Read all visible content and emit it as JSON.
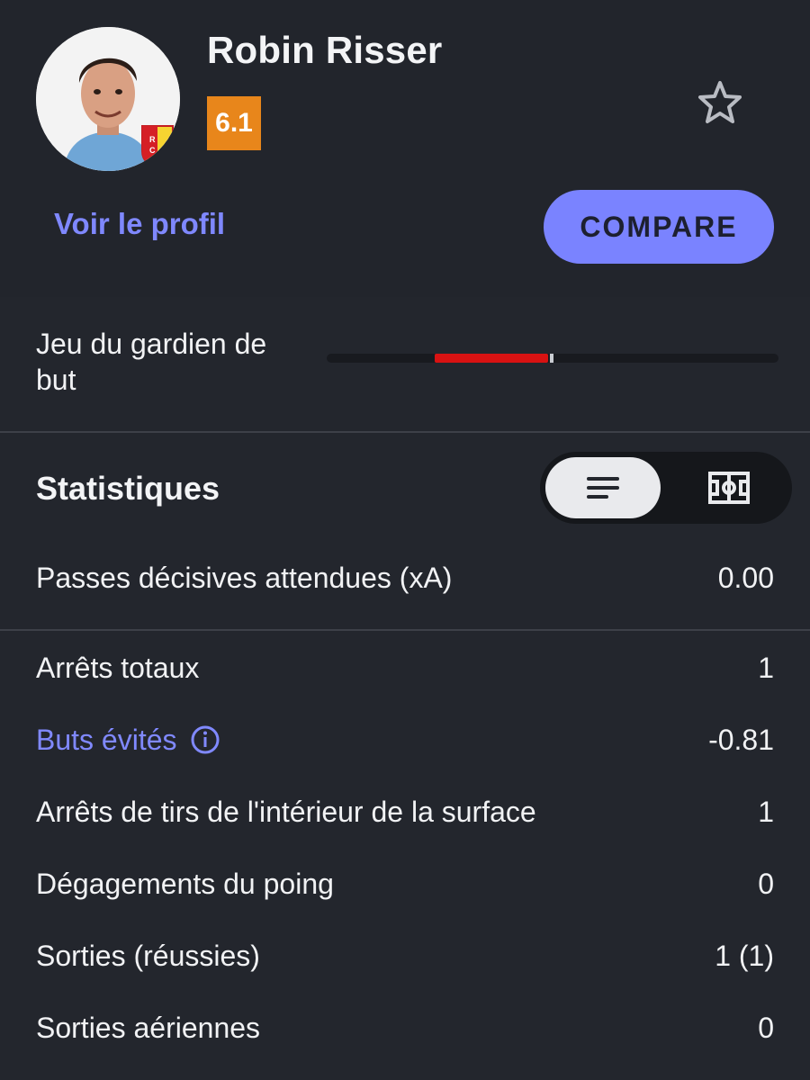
{
  "player": {
    "name": "Robin Risser",
    "rating": "6.1",
    "club_badge_icon": "rc-lens-badge-icon",
    "profile_link": "Voir le profil",
    "compare_label": "COMPARE"
  },
  "colors": {
    "background": "#23262d",
    "accent": "#7a83ff",
    "rating_badge": "#e8861b",
    "bar_negative": "#d81212"
  },
  "goalkeeping": {
    "label": "Jeu du gardien de but",
    "bar_start_fraction": 0.24,
    "bar_end_fraction": 0.49
  },
  "statistics": {
    "title": "Statistiques",
    "view_toggle": [
      "list-view-icon",
      "pitch-view-icon"
    ],
    "selected_view": "list-view-icon",
    "rows": [
      {
        "label": "Passes décisives attendues (xA)",
        "value": "0.00"
      },
      {
        "label": "Arrêts totaux",
        "value": "1"
      },
      {
        "label": "Buts évités",
        "value": "-0.81",
        "has_info": true
      },
      {
        "label": "Arrêts de tirs de l'intérieur de la surface",
        "value": "1"
      },
      {
        "label": "Dégagements du poing",
        "value": "0"
      },
      {
        "label": "Sorties (réussies)",
        "value": "1 (1)"
      },
      {
        "label": "Sorties aériennes",
        "value": "0"
      }
    ]
  }
}
